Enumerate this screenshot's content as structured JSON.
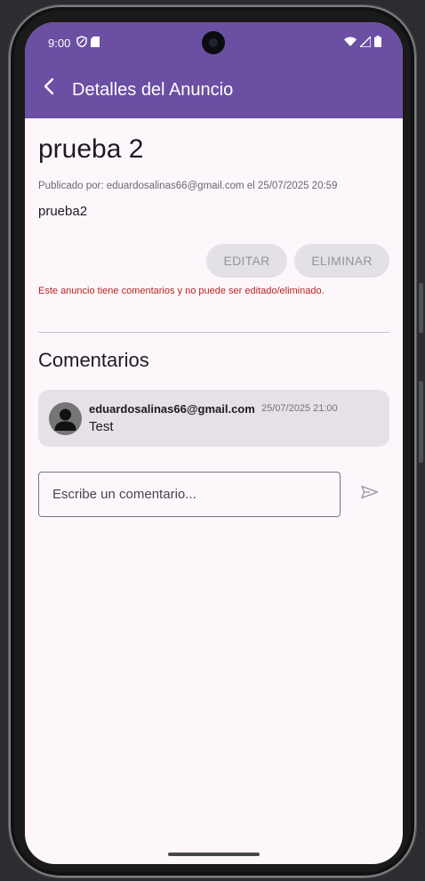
{
  "status_bar": {
    "time": "9:00",
    "left_icons": [
      "shield-icon",
      "sd-card-icon"
    ],
    "right_icons": [
      "wifi-icon",
      "signal-icon",
      "battery-icon"
    ]
  },
  "app_bar": {
    "title": "Detalles del Anuncio",
    "back_icon": "arrow-back-icon",
    "color": "#6a4fa3"
  },
  "post": {
    "title": "prueba 2",
    "meta": "Publicado por: eduardosalinas66@gmail.com el 25/07/2025 20:59",
    "body": "prueba2"
  },
  "actions": {
    "edit_label": "EDITAR",
    "delete_label": "ELIMINAR",
    "warning": "Este anuncio tiene comentarios y no puede ser editado/eliminado.",
    "warning_color": "#b3261e"
  },
  "comments": {
    "heading": "Comentarios",
    "items": [
      {
        "author": "eduardosalinas66@gmail.com",
        "date": "25/07/2025 21:00",
        "text": "Test",
        "avatar_icon": "person-icon"
      }
    ]
  },
  "comment_form": {
    "value": "",
    "placeholder": "Escribe un comentario...",
    "send_icon": "send-icon"
  }
}
